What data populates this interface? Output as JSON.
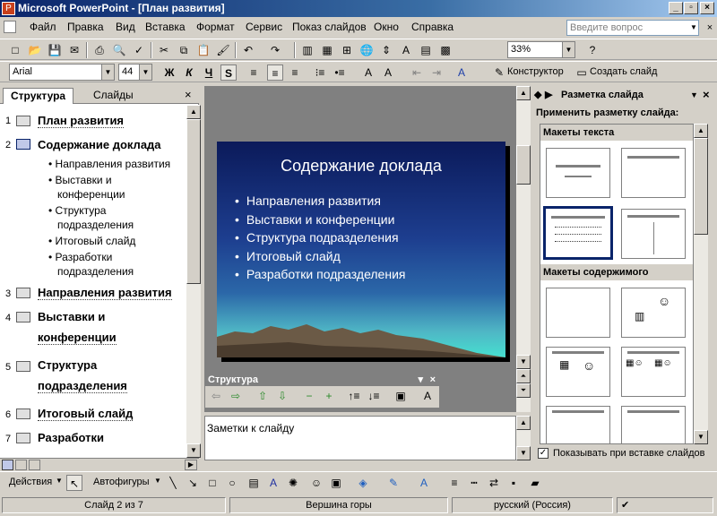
{
  "window": {
    "title": "Microsoft PowerPoint - [План развития]"
  },
  "menu": [
    "Файл",
    "Правка",
    "Вид",
    "Вставка",
    "Формат",
    "Сервис",
    "Показ слайдов",
    "Окно",
    "Справка"
  ],
  "help_placeholder": "Введите вопрос",
  "toolbar": {
    "zoom": "33%",
    "font": "Arial",
    "font_size": "44",
    "bold": "Ж",
    "italic": "К",
    "underline": "Ч",
    "shadow": "S",
    "design_label": "Конструктор",
    "new_slide_label": "Создать слайд"
  },
  "left_tabs": {
    "outline": "Структура",
    "slides": "Слайды"
  },
  "outline": {
    "slides": [
      {
        "num": "1",
        "title": "План развития"
      },
      {
        "num": "2",
        "title": "Содержание доклада"
      },
      {
        "num": "3",
        "title": "Направления развития"
      },
      {
        "num": "4",
        "title": "Выставки и",
        "title2": "конференции"
      },
      {
        "num": "5",
        "title": "Структура",
        "title2": "подразделения"
      },
      {
        "num": "6",
        "title": "Итоговый слайд"
      },
      {
        "num": "7",
        "title": "Разработки"
      }
    ],
    "bullets": [
      {
        "l1": "Направления развития"
      },
      {
        "l1": "Выставки и",
        "l2": "конференции"
      },
      {
        "l1": "Структура",
        "l2": "подразделения"
      },
      {
        "l1": "Итоговый слайд"
      },
      {
        "l1": "Разработки",
        "l2": "подразделения"
      }
    ]
  },
  "slide": {
    "title": "Содержание доклада",
    "bullets": [
      "Направления развития",
      "Выставки и конференции",
      "Структура подразделения",
      "Итоговый слайд",
      "Разработки подразделения"
    ]
  },
  "structure_toolbar": {
    "title": "Структура"
  },
  "notes": {
    "text": "Заметки к слайду"
  },
  "task_pane": {
    "title": "Разметка слайда",
    "apply_label": "Применить разметку слайда:",
    "group_text": "Макеты текста",
    "group_content": "Макеты содержимого",
    "show_on_insert": "Показывать при вставке слайдов"
  },
  "drawing_toolbar": {
    "actions": "Действия",
    "autoshapes": "Автофигуры"
  },
  "status": {
    "slide": "Слайд 2 из 7",
    "design": "Вершина горы",
    "language": "русский (Россия)"
  },
  "colors": {
    "title_bar": "#0a246a",
    "slide_top": "#0b1a5a",
    "slide_bottom": "#46e0d0"
  }
}
